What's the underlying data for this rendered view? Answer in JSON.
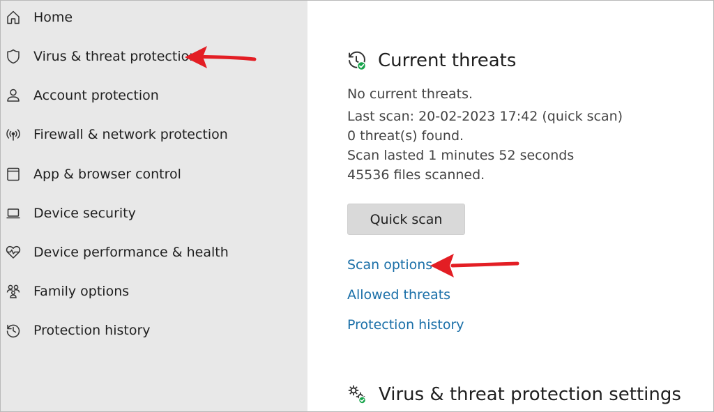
{
  "sidebar": {
    "items": [
      {
        "label": "Home",
        "icon": "home-icon"
      },
      {
        "label": "Virus & threat protection",
        "icon": "shield-icon"
      },
      {
        "label": "Account protection",
        "icon": "person-icon"
      },
      {
        "label": "Firewall & network protection",
        "icon": "wifi-antenna-icon"
      },
      {
        "label": "App & browser control",
        "icon": "app-window-icon"
      },
      {
        "label": "Device security",
        "icon": "laptop-icon"
      },
      {
        "label": "Device performance & health",
        "icon": "heart-pulse-icon"
      },
      {
        "label": "Family options",
        "icon": "family-icon"
      },
      {
        "label": "Protection history",
        "icon": "history-icon"
      }
    ]
  },
  "current_threats": {
    "title": "Current threats",
    "status": "No current threats.",
    "last_scan": "Last scan: 20-02-2023 17:42 (quick scan)",
    "threats_found": "0 threat(s) found.",
    "duration": "Scan lasted 1 minutes 52 seconds",
    "files_scanned": "45536 files scanned.",
    "quick_scan_label": "Quick scan",
    "links": {
      "scan_options": "Scan options",
      "allowed_threats": "Allowed threats",
      "protection_history": "Protection history"
    }
  },
  "settings": {
    "title": "Virus & threat protection settings"
  },
  "colors": {
    "sidebar_bg": "#e8e8e8",
    "link": "#1a6fa8",
    "annotation_arrow": "#e31e24",
    "status_ok": "#16a34a"
  }
}
